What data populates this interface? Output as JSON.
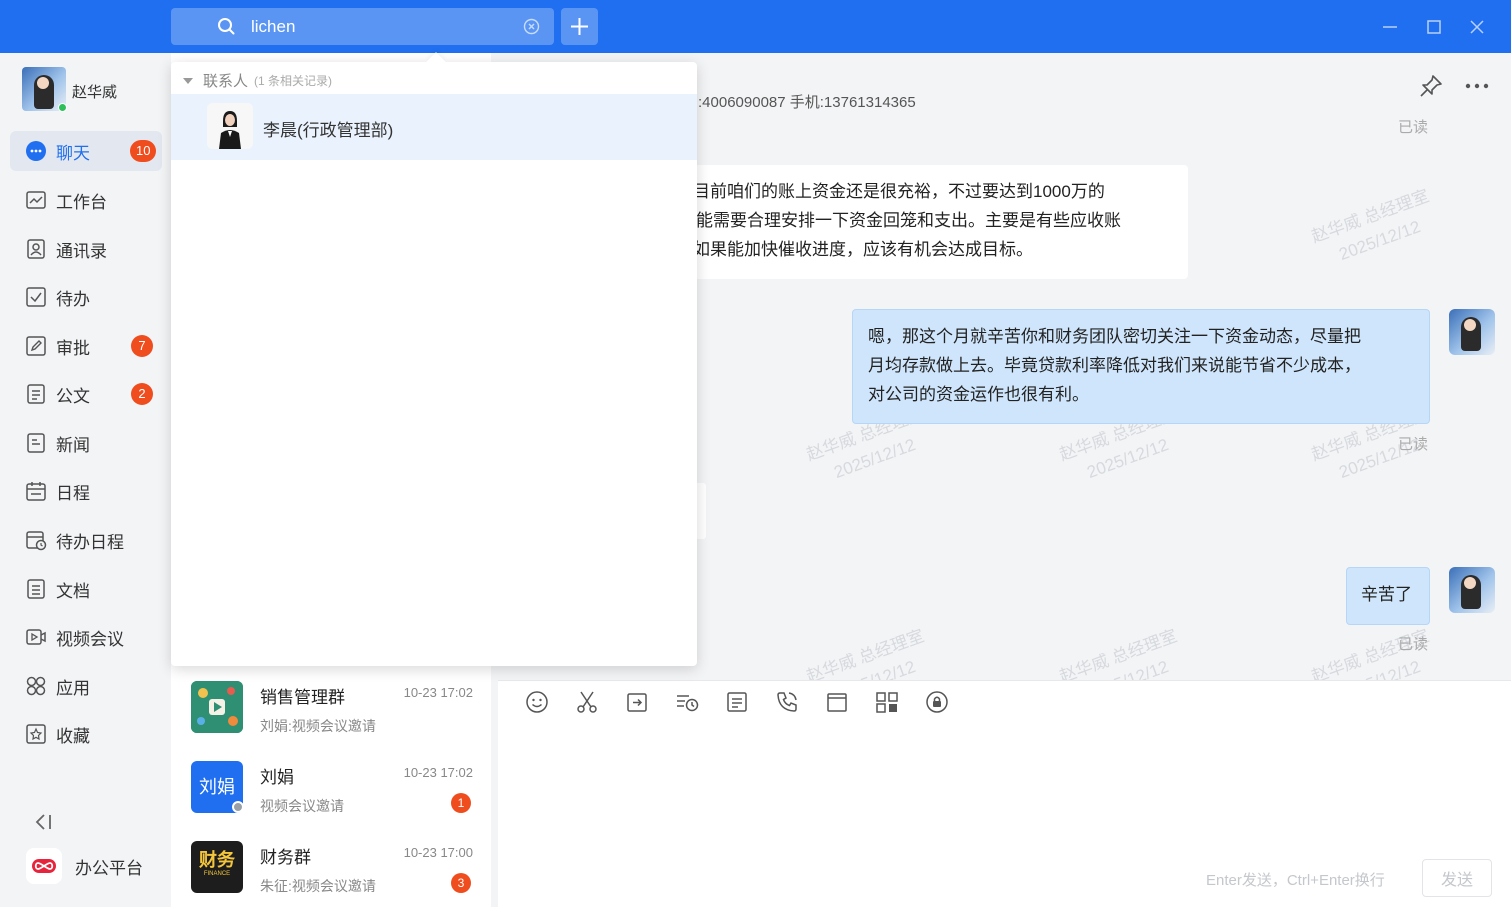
{
  "search": {
    "value": "lichen"
  },
  "user": {
    "name": "赵华威"
  },
  "nav": {
    "items": [
      {
        "label": "聊天",
        "icon": "chat-icon",
        "badge": "10",
        "active": true
      },
      {
        "label": "工作台",
        "icon": "dashboard-icon"
      },
      {
        "label": "通讯录",
        "icon": "contacts-icon"
      },
      {
        "label": "待办",
        "icon": "todo-icon"
      },
      {
        "label": "审批",
        "icon": "approval-icon",
        "badge": "7"
      },
      {
        "label": "公文",
        "icon": "document-icon",
        "badge": "2"
      },
      {
        "label": "新闻",
        "icon": "news-icon"
      },
      {
        "label": "日程",
        "icon": "calendar-icon"
      },
      {
        "label": "待办日程",
        "icon": "todo-calendar-icon"
      },
      {
        "label": "文档",
        "icon": "file-icon"
      },
      {
        "label": "视频会议",
        "icon": "video-icon"
      },
      {
        "label": "应用",
        "icon": "apps-icon"
      },
      {
        "label": "收藏",
        "icon": "favorites-icon"
      }
    ],
    "platform_label": "办公平台"
  },
  "dropdown": {
    "section_label": "联系人",
    "section_count": "(1 条相关记录)",
    "results": [
      {
        "name": "李晨(行政管理部)"
      }
    ]
  },
  "conversations": [
    {
      "name": "销售管理群",
      "time": "10-23 17:02",
      "message": "刘娟:视频会议邀请"
    },
    {
      "name": "刘娟",
      "time": "10-23 17:02",
      "message": "视频会议邀请",
      "badge": "1",
      "avatar_text": "刘娟"
    },
    {
      "name": "财务群",
      "time": "10-23 17:00",
      "message": "朱征:视频会议邀请",
      "badge": "3",
      "avatar_text": "财务",
      "avatar_subtext": "FINANCE"
    }
  ],
  "chat": {
    "contact_info": ":4006090087 手机:13761314365",
    "read_label": "已读",
    "messages": [
      {
        "side": "left",
        "lines": [
          "目前咱们的账上资金还是很充裕，不过要达到1000万的",
          "可能需要合理安排一下资金回笼和支出。主要是有些应收账",
          "如果能加快催收进度，应该有机会达成目标。"
        ]
      },
      {
        "side": "right",
        "lines": [
          "嗯，那这个月就辛苦你和财务团队密切关注一下资金动态，尽量把",
          "月均存款做上去。毕竟贷款利率降低对我们来说能节省不少成本，",
          "对公司的资金运作也很有利。"
        ]
      },
      {
        "side": "right",
        "lines": [
          "辛苦了"
        ]
      }
    ],
    "watermark": {
      "name": "赵华威 总经理室",
      "date": "2025/12/12"
    }
  },
  "composer": {
    "hint": "Enter发送，Ctrl+Enter换行",
    "send_label": "发送"
  },
  "colors": {
    "accent": "#1f6ff0",
    "badge": "#f04d1f",
    "bubble_self": "#cfe5fb"
  }
}
